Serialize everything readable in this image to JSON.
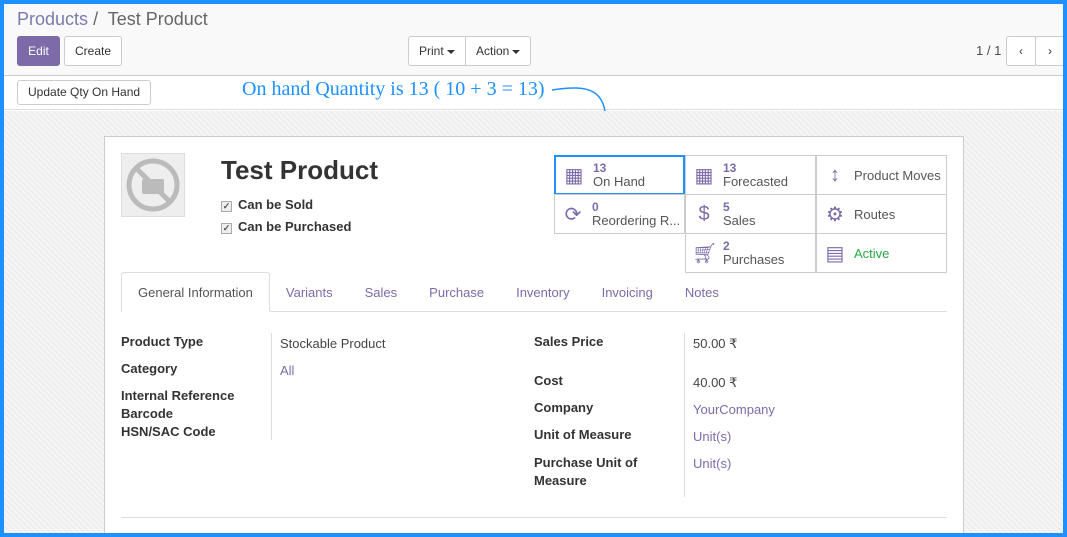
{
  "breadcrumb": {
    "parent": "Products",
    "separator": "/",
    "current": "Test Product"
  },
  "toolbar": {
    "edit": "Edit",
    "create": "Create",
    "print": "Print",
    "action": "Action",
    "pager": "1 / 1"
  },
  "update_qty": "Update Qty On Hand",
  "annotation": "On hand Quantity is 13 ( 10 + 3 = 13)",
  "product": {
    "name": "Test Product",
    "can_be_sold": "Can be Sold",
    "can_be_purchased": "Can be Purchased"
  },
  "smart_buttons": [
    {
      "value": "13",
      "label": "On Hand",
      "icon": "building-icon"
    },
    {
      "value": "13",
      "label": "Forecasted",
      "icon": "building-icon"
    },
    {
      "value": "",
      "label": "Product Moves",
      "icon": "arrows-v-icon"
    },
    {
      "value": "0",
      "label": "Reordering R...",
      "icon": "refresh-icon"
    },
    {
      "value": "5",
      "label": "Sales",
      "icon": "dollar-icon"
    },
    {
      "value": "",
      "label": "Routes",
      "icon": "cogs-icon"
    },
    {
      "value": "2",
      "label": "Purchases",
      "icon": "cart-icon"
    },
    {
      "value": "",
      "label": "Active",
      "icon": "archive-icon"
    }
  ],
  "tabs": [
    "General Information",
    "Variants",
    "Sales",
    "Purchase",
    "Inventory",
    "Invoicing",
    "Notes"
  ],
  "left_fields": {
    "product_type_label": "Product Type",
    "product_type": "Stockable Product",
    "category_label": "Category",
    "category": "All",
    "internal_ref_label": "Internal Reference",
    "barcode_label": "Barcode",
    "hsn_label": "HSN/SAC Code"
  },
  "right_fields": {
    "sales_price_label": "Sales Price",
    "sales_price": "50.00 ₹",
    "cost_label": "Cost",
    "cost": "40.00 ₹",
    "company_label": "Company",
    "company": "YourCompany",
    "uom_label": "Unit of Measure",
    "uom": "Unit(s)",
    "purchase_uom_label": "Purchase Unit of Measure",
    "purchase_uom": "Unit(s)"
  },
  "colors": {
    "accent": "#7c6ba8",
    "annotation": "#1e90ff",
    "active": "#28a745"
  }
}
